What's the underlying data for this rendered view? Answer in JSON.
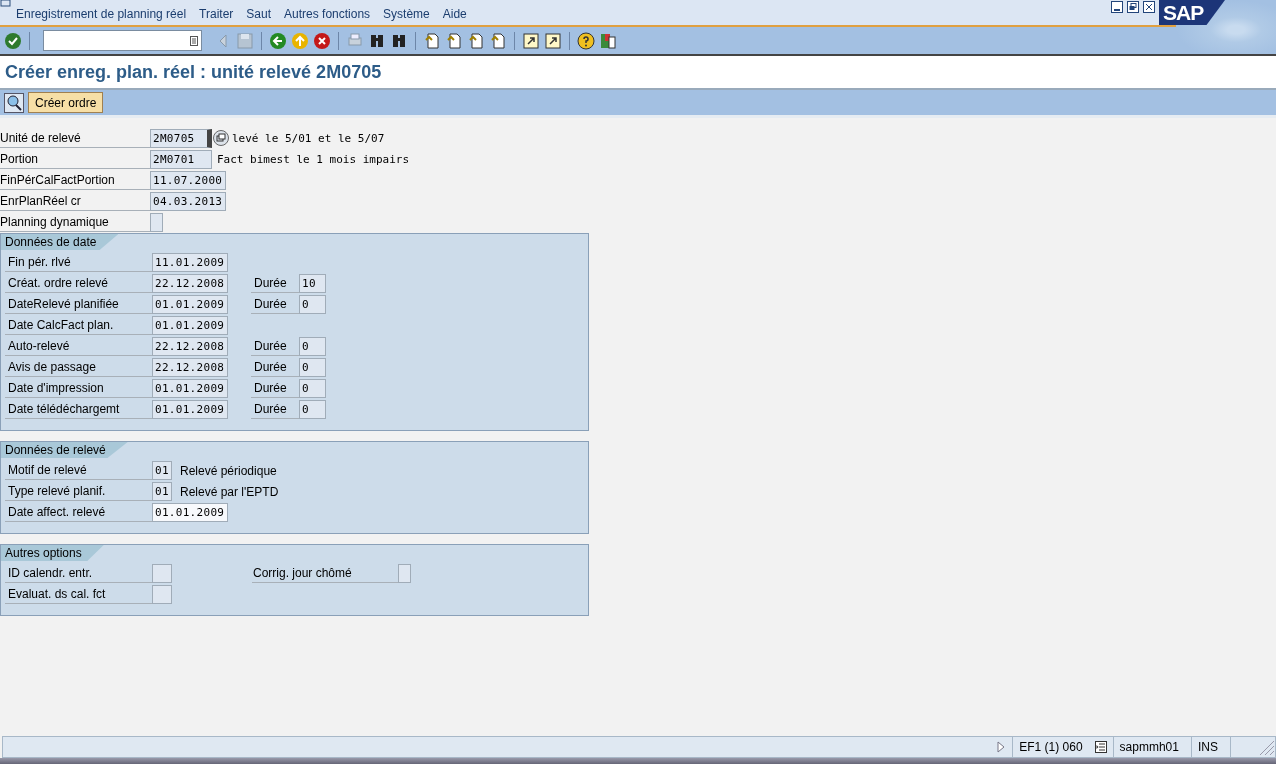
{
  "menu": [
    "Enregistrement de planning réel",
    "Traiter",
    "Saut",
    "Autres fonctions",
    "Système",
    "Aide"
  ],
  "logo": "SAP",
  "title": "Créer enreg. plan. réel : unité relevé 2M0705",
  "app_toolbar": {
    "button": "Créer ordre"
  },
  "header_fields": [
    {
      "label": "Unité de relevé",
      "value": "2M0705",
      "kind": "unit",
      "description": "levé le 5/01 et le 5/07"
    },
    {
      "label": "Portion",
      "value": "2M0701",
      "kind": "unit",
      "description": "Fact bimest le 1 mois impairs"
    },
    {
      "label": "FinPérCalFactPortion",
      "value": "11.07.2000",
      "kind": "date"
    },
    {
      "label": "EnrPlanRéel cr",
      "value": "04.03.2013",
      "kind": "date"
    },
    {
      "label": "Planning dynamique",
      "kind": "flag"
    }
  ],
  "sections": [
    {
      "title": "Données de date",
      "rows": [
        {
          "label": "Fin pér. rlvé",
          "value": "11.01.2009",
          "kind": "date"
        },
        {
          "label": "Créat. ordre relevé",
          "value": "22.12.2008",
          "kind": "date",
          "duration": {
            "label": "Durée",
            "value": "10"
          }
        },
        {
          "label": "DateRelevé planifiée",
          "value": "01.01.2009",
          "kind": "date",
          "duration": {
            "label": "Durée",
            "value": "0"
          }
        },
        {
          "label": "Date CalcFact plan.",
          "value": "01.01.2009",
          "kind": "date"
        },
        {
          "label": "Auto-relevé",
          "value": "22.12.2008",
          "kind": "date",
          "duration": {
            "label": "Durée",
            "value": "0"
          }
        },
        {
          "label": "Avis de passage",
          "value": "22.12.2008",
          "kind": "date",
          "duration": {
            "label": "Durée",
            "value": "0"
          }
        },
        {
          "label": "Date d'impression",
          "value": "01.01.2009",
          "kind": "date",
          "duration": {
            "label": "Durée",
            "value": "0"
          }
        },
        {
          "label": "Date télédéchargemt",
          "value": "01.01.2009",
          "kind": "date",
          "duration": {
            "label": "Durée",
            "value": "0"
          }
        }
      ]
    },
    {
      "title": "Données de relevé",
      "rows": [
        {
          "label": "Motif de relevé",
          "value": "01",
          "kind": "code",
          "description": "Relevé périodique"
        },
        {
          "label": "Type relevé planif.",
          "value": "01",
          "kind": "code",
          "description": "Relevé par l'EPTD"
        },
        {
          "label": "Date affect. relevé",
          "value": "01.01.2009",
          "kind": "date",
          "editable": true
        }
      ]
    },
    {
      "title": "Autres options",
      "rows": [
        {
          "label": "ID calendr. entr.",
          "kind": "option",
          "right": {
            "label": "Corrig. jour chômé",
            "kind": "flag"
          }
        },
        {
          "label": "Evaluat. ds cal. fct",
          "kind": "option"
        }
      ]
    }
  ],
  "status_bar": [
    "EF1 (1) 060",
    "sapmmh01",
    "INS"
  ]
}
